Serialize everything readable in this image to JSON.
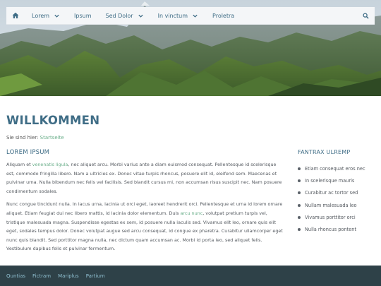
{
  "nav": {
    "items": [
      {
        "label": "Lorem",
        "has_dropdown": true
      },
      {
        "label": "Ipsum",
        "has_dropdown": false
      },
      {
        "label": "Sed Dolor",
        "has_dropdown": true
      },
      {
        "label": "In vinctum",
        "has_dropdown": true
      },
      {
        "label": "Proletra",
        "has_dropdown": false
      }
    ],
    "home_icon": "home-icon",
    "search_icon": "search-icon"
  },
  "page": {
    "title": "WILLKOMMEN",
    "breadcrumb_prefix": "Sie sind hier:",
    "breadcrumb_link": "Startseite"
  },
  "main": {
    "heading": "LOREM IPSUM",
    "p1_a": "Aliquam et ",
    "p1_link": "venenatis ligula",
    "p1_b": ", nec aliquet arcu. Morbi varius ante a diam euismod consequat. Pellentesque id scelerisque est, commodo fringilla libero. Nam a ultricies ex. Donec vitae turpis rhoncus, posuere elit id, eleifend sem. Maecenas et pulvinar urna. Nulla bibendum nec felis vel facilisis. Sed blandit cursus mi, non accumsan risus suscipit nec. Nam posuere condimentum sodales.",
    "p2_a": "Nunc congue tincidunt nulla. In lacus urna, lacinia ut orci eget, laoreet hendrerit orci. Pellentesque et urna id lorem ornare aliquet. Etiam feugiat dui nec libero mattis, id lacinia dolor elementum. Duis ",
    "p2_link": "arcu nunc",
    "p2_b": ", volutpat pretium turpis vel, tristique malesuada magna. Suspendisse egestas ex sem, id posuere nulla iaculis sed. Vivamus elit leo, ornare quis elit eget, sodales tempus dolor. Donec volutpat augue sed arcu consequat, id congue ex pharetra. Curabitur ullamcorper eget nunc quis blandit. Sed porttitor magna nulla, nec dictum quam accumsan ac. Morbi id porta leo, sed aliquet felis. Vestibulum dapibus felis et pulvinar fermentum."
  },
  "sidebar": {
    "heading": "FANTRAX ULREMP",
    "items": [
      "Etiam consequat eros nec",
      "In scelerisque mauris",
      "Curabitur ac tortor sed",
      "Nullam malesuada leo",
      "Vivamus porttitor orci",
      "Nulla rhoncus pontent"
    ]
  },
  "footer": {
    "links": [
      "Quntias",
      "Fictram",
      "Mariplus",
      "Partium"
    ]
  },
  "colors": {
    "accent": "#3f6d86",
    "link": "#6aae8a",
    "footer_bg": "#2e4148",
    "footer_link": "#8fbfd0"
  }
}
